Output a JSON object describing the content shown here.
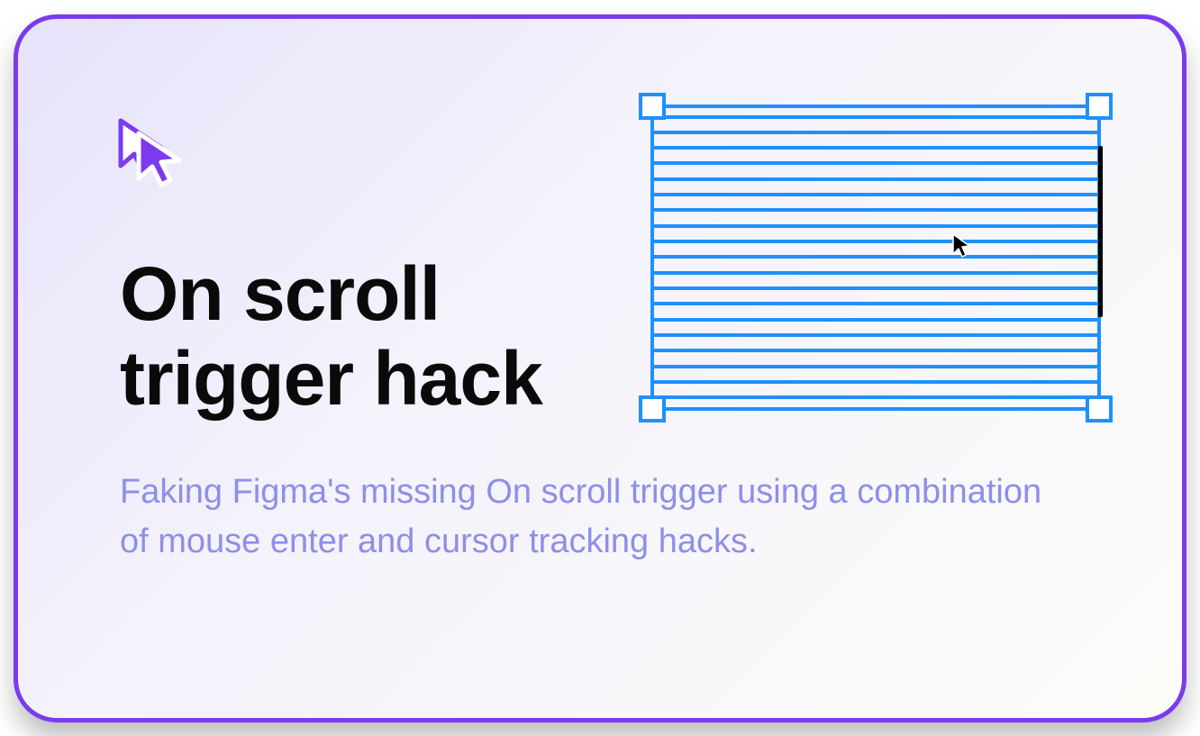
{
  "card": {
    "title_line1": "On scroll",
    "title_line2": "trigger hack",
    "subtitle": "Faking Figma's missing On scroll trigger using a combination of mouse enter and cursor tracking hacks."
  },
  "colors": {
    "border": "#7C3AED",
    "selection": "#1E90FF",
    "subtitle": "#8D8FE9"
  },
  "figure": {
    "line_count": 19
  },
  "icons": {
    "hero": "double-cursor-icon",
    "inner": "cursor-icon"
  }
}
